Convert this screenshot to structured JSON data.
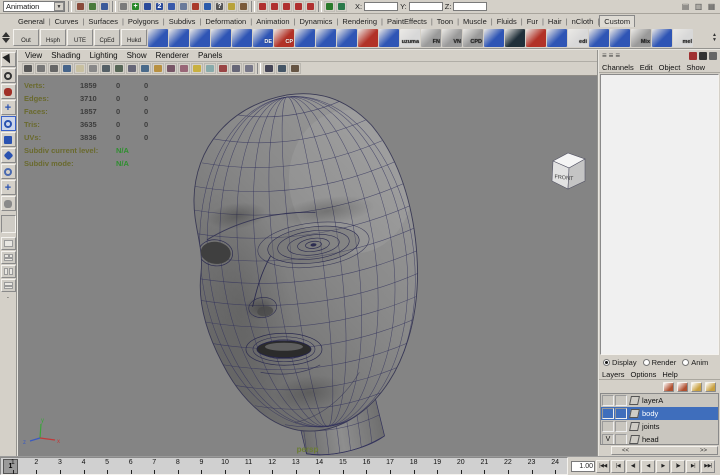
{
  "statusbar": {
    "mode": "Animation",
    "coord_fields": [
      {
        "label": "X:",
        "value": ""
      },
      {
        "label": "Y:",
        "value": ""
      },
      {
        "label": "Z:",
        "value": ""
      }
    ],
    "icons": [
      {
        "n": "new-scene-icon",
        "c": "#8a4a3a"
      },
      {
        "n": "open-scene-icon",
        "c": "#4a7a3a"
      },
      {
        "n": "save-scene-icon",
        "c": "#3a5a9a"
      },
      {
        "n": "sep"
      },
      {
        "n": "select-hierarchy-icon",
        "c": "#7a7a7a"
      },
      {
        "n": "add-selection-icon",
        "c": "#2a8a2a",
        "g": "+"
      },
      {
        "n": "pencil-edit-icon",
        "c": "#2a4a9a"
      },
      {
        "n": "layer-two-icon",
        "c": "#2a4a9a",
        "g": "2"
      },
      {
        "n": "panel-icon",
        "c": "#3a5aaa"
      },
      {
        "n": "duplicate-icon",
        "c": "#6a7a9a"
      },
      {
        "n": "highlight-icon",
        "c": "#aa3a2a"
      },
      {
        "n": "globe-icon",
        "c": "#2a5aaa"
      },
      {
        "n": "help-line-icon",
        "c": "#555555",
        "g": "?"
      },
      {
        "n": "lock-icon",
        "c": "#b8a23a"
      },
      {
        "n": "history-icon",
        "c": "#7a5a3a"
      },
      {
        "n": "sep"
      },
      {
        "n": "snap-grid-icon",
        "c": "#b03030"
      },
      {
        "n": "snap-curve-icon",
        "c": "#b03030"
      },
      {
        "n": "snap-point-icon",
        "c": "#b03030"
      },
      {
        "n": "snap-view-plane-icon",
        "c": "#b03030"
      },
      {
        "n": "snap-surface-icon",
        "c": "#b03030"
      },
      {
        "n": "sep"
      },
      {
        "n": "input-connections-icon",
        "c": "#2a7a2a"
      },
      {
        "n": "output-connections-icon",
        "c": "#2a7a4a"
      }
    ],
    "right_icons": [
      {
        "n": "toggle-attribute-editor-icon",
        "g": "▤"
      },
      {
        "n": "toggle-tool-settings-icon",
        "g": "▥"
      },
      {
        "n": "toggle-channel-box-icon",
        "g": "▦"
      }
    ]
  },
  "shelf": {
    "tabs": [
      "General",
      "Curves",
      "Surfaces",
      "Polygons",
      "Subdivs",
      "Deformation",
      "Animation",
      "Dynamics",
      "Rendering",
      "PaintEffects",
      "Toon",
      "Muscle",
      "Fluids",
      "Fur",
      "Hair",
      "nCloth",
      "Custom"
    ],
    "active_tab": "Custom",
    "buttons": [
      "Out",
      "Hsph",
      "UTE",
      "CpEd",
      "Hukd"
    ],
    "items": [
      {
        "n": "poly-model-shelf-item",
        "c": "#2f55b5"
      },
      {
        "n": "poly-mirror-shelf-item",
        "c": "#2f55b5"
      },
      {
        "n": "poly-split-shelf-item",
        "c": "#2f55b5"
      },
      {
        "n": "poly-grid-a-shelf-item",
        "c": "#2f55b5"
      },
      {
        "n": "poly-grid-b-shelf-item",
        "c": "#2f55b5"
      },
      {
        "n": "de-script-shelf-item",
        "c": "#2f55b5",
        "l": "DE"
      },
      {
        "n": "cp-script-shelf-item",
        "c": "#b23227",
        "l": "CP"
      },
      {
        "n": "poly-grid-c-shelf-item",
        "c": "#2f55b5"
      },
      {
        "n": "poly-tool-a-shelf-item",
        "c": "#2f55b5"
      },
      {
        "n": "poly-tool-b-shelf-item",
        "c": "#2f55b5"
      },
      {
        "n": "spray-shelf-item",
        "c": "#b23227"
      },
      {
        "n": "poly-rows-shelf-item",
        "c": "#2f55b5"
      },
      {
        "n": "mel-uzuma-shelf-item",
        "c": "#d8d8d8",
        "l": "uzuma"
      },
      {
        "n": "fn-script-shelf-item",
        "c": "#9a9a9a",
        "l": "FN"
      },
      {
        "n": "vn-script-shelf-item",
        "c": "#9a9a9a",
        "l": "VN"
      },
      {
        "n": "cpd-script-shelf-item",
        "c": "#9a9a9a",
        "l": "CPD"
      },
      {
        "n": "poly-pair-a-shelf-item",
        "c": "#2f55b5"
      },
      {
        "n": "circle-tool-shelf-item",
        "c": "#20303a"
      },
      {
        "n": "splash-tool-shelf-item",
        "c": "#b23227"
      },
      {
        "n": "poly-pair-b-shelf-item",
        "c": "#2f55b5"
      },
      {
        "n": "mel-edi-shelf-item",
        "c": "#d8d8d8",
        "l": "edi"
      },
      {
        "n": "bucket-a-shelf-item",
        "c": "#2f55b5"
      },
      {
        "n": "bucket-b-shelf-item",
        "c": "#2f55b5"
      },
      {
        "n": "mix-script-shelf-item",
        "c": "#9a9a9a",
        "l": "Mix"
      },
      {
        "n": "poly-pair-c-shelf-item",
        "c": "#2f55b5"
      },
      {
        "n": "mel-page-shelf-item",
        "c": "#d8d8d8",
        "l": "mel"
      }
    ]
  },
  "toolbox": {
    "tools": [
      {
        "n": "select-tool",
        "c": "#222222",
        "k": "arrow"
      },
      {
        "n": "lasso-tool",
        "c": "#333333",
        "k": "ring"
      },
      {
        "n": "paint-select-tool",
        "c": "#a03028",
        "k": "blob"
      },
      {
        "n": "move-tool",
        "c": "#2a52b0",
        "k": "plus"
      },
      {
        "n": "rotate-tool",
        "c": "#2a52b0",
        "k": "ring",
        "sel": true
      },
      {
        "n": "scale-tool",
        "c": "#2a52b0",
        "k": "square"
      },
      {
        "n": "universal-manipulator-tool",
        "c": "#2a52b0",
        "k": "diamond"
      },
      {
        "n": "soft-mod-tool",
        "c": "#4a6ab0",
        "k": "ring"
      },
      {
        "n": "show-manipulator-tool",
        "c": "#2a52b0",
        "k": "plus"
      },
      {
        "n": "last-tool-icon",
        "c": "#8a8a8a",
        "k": "blob"
      }
    ],
    "layouts": [
      "single-pane-layout-button",
      "four-pane-layout-button",
      "persp-outliner-layout-button",
      "hypershade-persp-layout-button"
    ]
  },
  "viewport": {
    "menus": [
      "View",
      "Shading",
      "Lighting",
      "Show",
      "Renderer",
      "Panels"
    ],
    "icons": [
      {
        "n": "select-camera-icon",
        "c": "#555555"
      },
      {
        "n": "grid-icon",
        "c": "#777777"
      },
      {
        "n": "film-gate-icon",
        "c": "#666666"
      },
      {
        "n": "resolution-gate-icon",
        "c": "#46648a"
      },
      {
        "n": "gate-mask-icon",
        "c": "#c8c0a0"
      },
      {
        "n": "field-chart-icon",
        "c": "#888888"
      },
      {
        "n": "safe-action-icon",
        "c": "#556066"
      },
      {
        "n": "safe-title-icon",
        "c": "#566656"
      },
      {
        "n": "wireframe-mode-icon",
        "c": "#666677"
      },
      {
        "n": "smooth-shade-icon",
        "c": "#4a6a8a"
      },
      {
        "n": "flat-shade-icon",
        "c": "#b89040"
      },
      {
        "n": "bounding-box-icon",
        "c": "#775566"
      },
      {
        "n": "textured-mode-icon",
        "c": "#996677"
      },
      {
        "n": "lighting-all-icon",
        "c": "#c8b040"
      },
      {
        "n": "lighting-default-icon",
        "c": "#88aaaa"
      },
      {
        "n": "shadows-icon",
        "c": "#994444"
      },
      {
        "n": "xray-icon",
        "c": "#666677"
      },
      {
        "n": "isolate-select-icon",
        "c": "#777788"
      },
      {
        "n": "sep"
      },
      {
        "n": "image-plane-icon",
        "c": "#444455"
      },
      {
        "n": "grease-pencil-icon",
        "c": "#445566"
      },
      {
        "n": "snapshot-icon",
        "c": "#665544"
      }
    ],
    "hud": {
      "rows": [
        {
          "label": "Verts:",
          "v1": "1859",
          "v2": "0",
          "v3": "0"
        },
        {
          "label": "Edges:",
          "v1": "3710",
          "v2": "0",
          "v3": "0"
        },
        {
          "label": "Faces:",
          "v1": "1857",
          "v2": "0",
          "v3": "0"
        },
        {
          "label": "Tris:",
          "v1": "3635",
          "v2": "0",
          "v3": "0"
        },
        {
          "label": "UVs:",
          "v1": "3836",
          "v2": "0",
          "v3": "0"
        }
      ],
      "subdiv": [
        {
          "label": "Subdiv current level:",
          "value": "N/A"
        },
        {
          "label": "Subdiv mode:",
          "value": "N/A"
        }
      ]
    },
    "camera": "persp",
    "cube_label": "FRONT",
    "axis": {
      "x": "x",
      "y": "y",
      "z": "z"
    }
  },
  "channel_box": {
    "menus": [
      "Channels",
      "Edit",
      "Object",
      "Show"
    ],
    "left_icons": [
      {
        "n": "channel-layout-thin-icon",
        "g": "≡"
      },
      {
        "n": "channel-layout-wide-icon",
        "g": "≡"
      },
      {
        "n": "channel-layout-large-icon",
        "g": "≡"
      }
    ],
    "right_icons": [
      {
        "n": "channel-colors-icon",
        "c": "#a03030"
      },
      {
        "n": "speed-state-icon",
        "c": "#333333"
      },
      {
        "n": "hyperbolic-slider-icon",
        "c": "#666666"
      }
    ]
  },
  "layer_editor": {
    "radios": [
      "Display",
      "Render",
      "Anim"
    ],
    "selected_radio": "Display",
    "menus": [
      "Layers",
      "Options",
      "Help"
    ],
    "icons": [
      {
        "n": "layer-up-icon",
        "c": "#b05030"
      },
      {
        "n": "layer-down-icon",
        "c": "#b05030"
      },
      {
        "n": "new-empty-layer-icon",
        "c": "#c8a040"
      },
      {
        "n": "new-layer-from-selected-icon",
        "c": "#c8a040"
      }
    ],
    "rows": [
      {
        "vis": "",
        "name": "layerA",
        "selected": false
      },
      {
        "vis": "",
        "name": "body",
        "selected": true
      },
      {
        "vis": "",
        "name": "joints",
        "selected": false
      },
      {
        "vis": "V",
        "name": "head",
        "selected": false
      }
    ]
  },
  "timeline": {
    "start": 1,
    "end": 24,
    "current": "1"
  },
  "playback": {
    "speed": "1.00",
    "scroll_left": "<<",
    "scroll_right": ">>",
    "buttons": [
      {
        "n": "go-to-start-button",
        "g": "|◀◀"
      },
      {
        "n": "step-back-key-button",
        "g": "|◀"
      },
      {
        "n": "step-back-frame-button",
        "g": "◀|"
      },
      {
        "n": "play-backwards-button",
        "g": "◀"
      },
      {
        "n": "play-forwards-button",
        "g": "▶"
      },
      {
        "n": "step-forward-frame-button",
        "g": "|▶"
      },
      {
        "n": "step-forward-key-button",
        "g": "▶|"
      },
      {
        "n": "go-to-end-button",
        "g": "▶▶|"
      }
    ]
  }
}
